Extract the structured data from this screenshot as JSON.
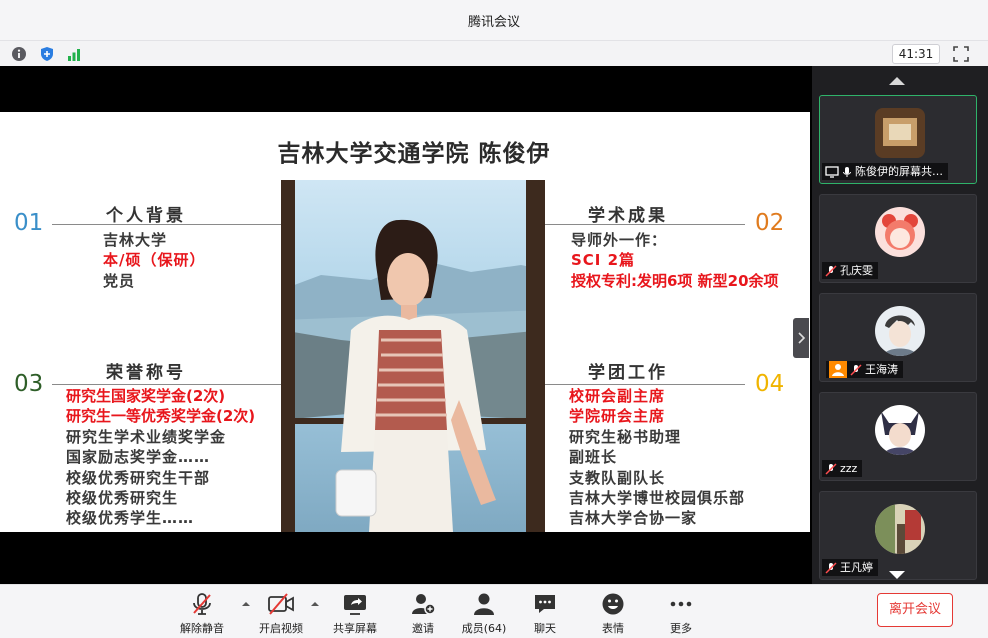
{
  "window": {
    "title": "腾讯会议"
  },
  "infobar": {
    "timer": "41:31"
  },
  "slide": {
    "title": "吉林大学交通学院  陈俊伊",
    "sections": [
      {
        "num": "01",
        "title": "个人背景",
        "lines": [
          "吉林大学",
          "本/硕（保研）",
          "党员"
        ]
      },
      {
        "num": "02",
        "title": "学术成果",
        "lines": [
          "导师外一作：",
          "SCI 2篇",
          "授权专利:发明6项  新型20余项"
        ]
      },
      {
        "num": "03",
        "title": "荣誉称号",
        "lines": [
          "研究生国家奖学金(2次)",
          "研究生一等优秀奖学金(2次)",
          "研究生学术业绩奖学金",
          "国家励志奖学金……",
          "校级优秀研究生干部",
          "校级优秀研究生",
          "校级优秀学生……"
        ]
      },
      {
        "num": "04",
        "title": "学团工作",
        "lines": [
          "校研会副主席",
          "学院研会主席",
          "研究生秘书助理",
          "副班长",
          "支教队副队长",
          "吉林大学博世校园俱乐部",
          "吉林大学合协一家"
        ]
      }
    ],
    "colors": {
      "num01": "#3a8fc9",
      "num02": "#e07b1e",
      "num03": "#2e5e28",
      "num04": "#f0b400",
      "red": "#e8161c"
    }
  },
  "participants": [
    {
      "name": "陈俊伊的屏幕共…",
      "active": true
    },
    {
      "name": "孔庆雯",
      "active": false
    },
    {
      "name": "王海涛",
      "active": false
    },
    {
      "name": "zzz",
      "active": false
    },
    {
      "name": "王凡婷",
      "active": false
    }
  ],
  "toolbar": {
    "mute": "解除静音",
    "video": "开启视频",
    "share": "共享屏幕",
    "invite": "邀请",
    "members": "成员(64)",
    "chat": "聊天",
    "emoji": "表情",
    "more": "更多",
    "leave": "离开会议"
  },
  "icons": [
    "info-icon",
    "shield-icon",
    "signal-icon",
    "fullscreen-icon",
    "mic-muted-icon",
    "camera-off-icon",
    "share-screen-icon",
    "invite-icon",
    "members-icon",
    "chat-icon",
    "emoji-icon",
    "more-icon"
  ]
}
